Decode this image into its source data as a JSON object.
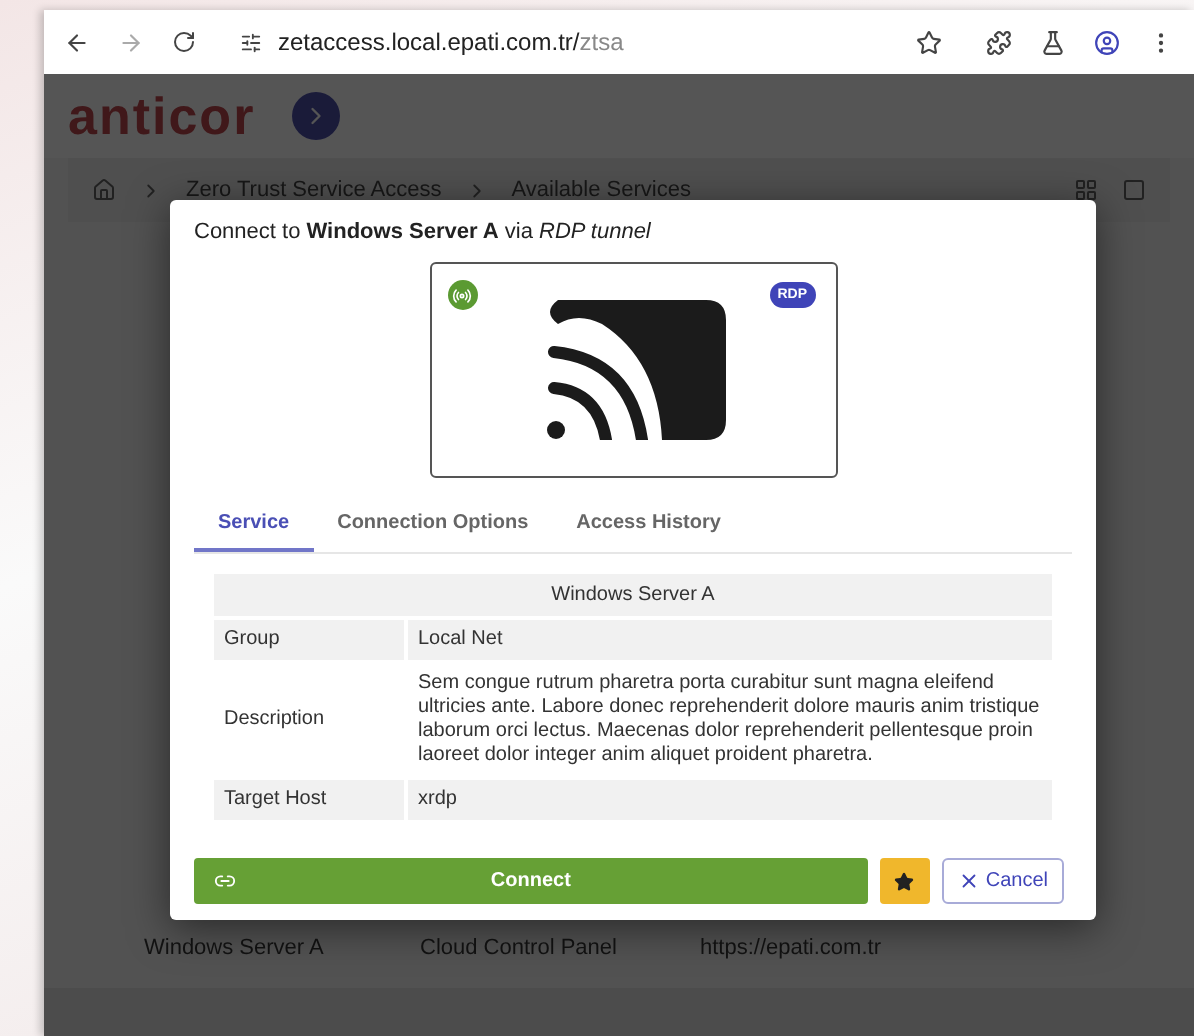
{
  "browser": {
    "url_host": "zetaccess.local.epati.com.tr/",
    "url_path": "ztsa"
  },
  "app": {
    "logo": "anticor",
    "breadcrumb": [
      "Zero Trust Service Access",
      "Available Services"
    ],
    "cards": [
      {
        "title": "Windows Server A"
      },
      {
        "title": "Cloud Control Panel"
      },
      {
        "title": "https://epati.com.tr"
      }
    ]
  },
  "dialog": {
    "title": "Connect to **Windows Server A** via *RDP tunnel*",
    "badge": "RDP",
    "tabs": [
      {
        "label": "Service",
        "selected": true
      },
      {
        "label": "Connection Options",
        "selected": false
      },
      {
        "label": "Access History",
        "selected": false
      }
    ],
    "table": {
      "heading": "Windows Server A",
      "rows": [
        {
          "label": "Group",
          "value": "Local Net"
        },
        {
          "label": "Description",
          "value": "Sem congue rutrum pharetra porta curabitur sunt magna eleifend ultricies ante. Labore donec reprehenderit dolore mauris anim tristique laborum orci lectus. Maecenas dolor reprehenderit pellentesque proin laoreet dolor integer anim aliquet proident pharetra."
        },
        {
          "label": "Target Host",
          "value": "xrdp"
        }
      ]
    },
    "connect": "Connect",
    "cancel": "Cancel"
  }
}
